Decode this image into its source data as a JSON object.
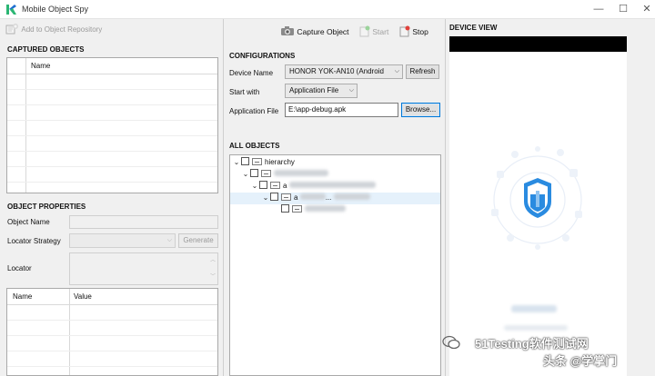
{
  "window": {
    "title": "Mobile Object Spy",
    "minimize": "—",
    "maximize": "☐",
    "close": "✕"
  },
  "left": {
    "add_repo": "Add to Object Repository",
    "captured_title": "CAPTURED OBJECTS",
    "captured_col_name": "Name",
    "props_title": "OBJECT PROPERTIES",
    "object_name_label": "Object Name",
    "locator_strategy_label": "Locator Strategy",
    "generate_label": "Generate",
    "locator_label": "Locator",
    "props_col_name": "Name",
    "props_col_value": "Value"
  },
  "toolbar": {
    "capture": "Capture Object",
    "start": "Start",
    "stop": "Stop"
  },
  "config": {
    "title": "CONFIGURATIONS",
    "device_name_label": "Device Name",
    "device_name_value": "HONOR YOK-AN10 (Android",
    "refresh_label": "Refresh",
    "start_with_label": "Start with",
    "start_with_value": "Application File",
    "app_file_label": "Application File",
    "app_file_value": "E:\\app-debug.apk",
    "browse_label": "Browse..."
  },
  "objects": {
    "title": "ALL OBJECTS",
    "root": "hierarchy",
    "node_a1": "a",
    "node_a2": "a",
    "node_a2_suffix": "..."
  },
  "device": {
    "title": "DEVICE VIEW"
  },
  "watermark": {
    "line1": "51Testing软件测试网",
    "line2": "头条 @学掌门"
  },
  "colors": {
    "accent": "#0078d7",
    "shield": "#2a8be0",
    "logo_green": "#2bb673",
    "logo_blue": "#1f6fd1"
  }
}
